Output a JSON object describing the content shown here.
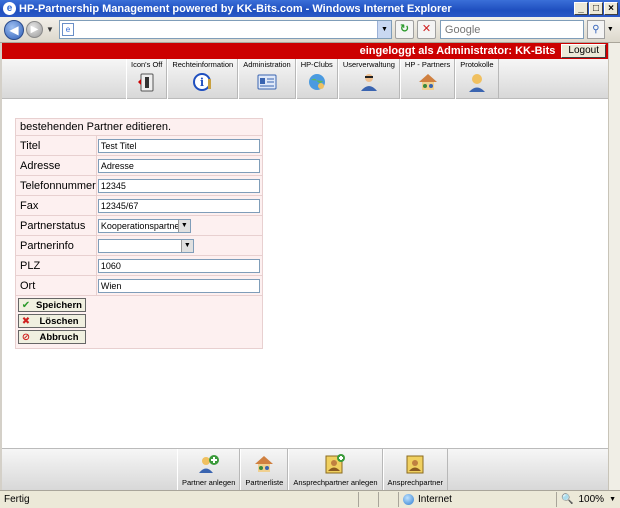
{
  "window": {
    "title": "HP-Partnership Management powered by KK-Bits.com - Windows Internet Explorer"
  },
  "addressbar": {
    "url": "",
    "search_placeholder": "Google"
  },
  "header": {
    "login_text": "eingeloggt als Administrator: KK-Bits",
    "logout_label": "Logout"
  },
  "topmenu": {
    "items": [
      {
        "label": "Icon's Off",
        "icon": "toggle-icon"
      },
      {
        "label": "Rechteinformation",
        "icon": "info-icon"
      },
      {
        "label": "Administration",
        "icon": "admin-card-icon"
      },
      {
        "label": "HP-Clubs",
        "icon": "globe-users-icon"
      },
      {
        "label": "Userverwaltung",
        "icon": "user-admin-icon"
      },
      {
        "label": "HP - Partners",
        "icon": "partners-house-icon"
      },
      {
        "label": "Protokolle",
        "icon": "protocol-user-icon"
      }
    ]
  },
  "form": {
    "heading": "bestehenden Partner editieren.",
    "fields": [
      {
        "label": "Titel",
        "value": "Test Titel"
      },
      {
        "label": "Adresse",
        "value": "Adresse"
      },
      {
        "label": "Telefonnummer",
        "value": "12345"
      },
      {
        "label": "Fax",
        "value": "12345/67"
      }
    ],
    "partnerstatus": {
      "label": "Partnerstatus",
      "value": "Kooperationspartner"
    },
    "partnerinfo": {
      "label": "Partnerinfo",
      "value": ""
    },
    "fields2": [
      {
        "label": "PLZ",
        "value": "1060"
      },
      {
        "label": "Ort",
        "value": "Wien"
      }
    ],
    "buttons": {
      "save": "Speichern",
      "delete": "Löschen",
      "cancel": "Abbruch"
    }
  },
  "bottommenu": {
    "items": [
      {
        "label": "Partner anlegen",
        "icon": "add-partner-icon"
      },
      {
        "label": "Partnerliste",
        "icon": "partner-list-icon"
      },
      {
        "label": "Ansprechpartner anlegen",
        "icon": "add-contact-icon"
      },
      {
        "label": "Ansprechpartner",
        "icon": "contact-icon"
      }
    ]
  },
  "statusbar": {
    "text": "Fertig",
    "zone": "Internet",
    "zoom": "100%"
  },
  "colors": {
    "header_red": "#cc0000",
    "form_bg": "#fdf0f0",
    "title_blue": "#1f4fbf"
  }
}
